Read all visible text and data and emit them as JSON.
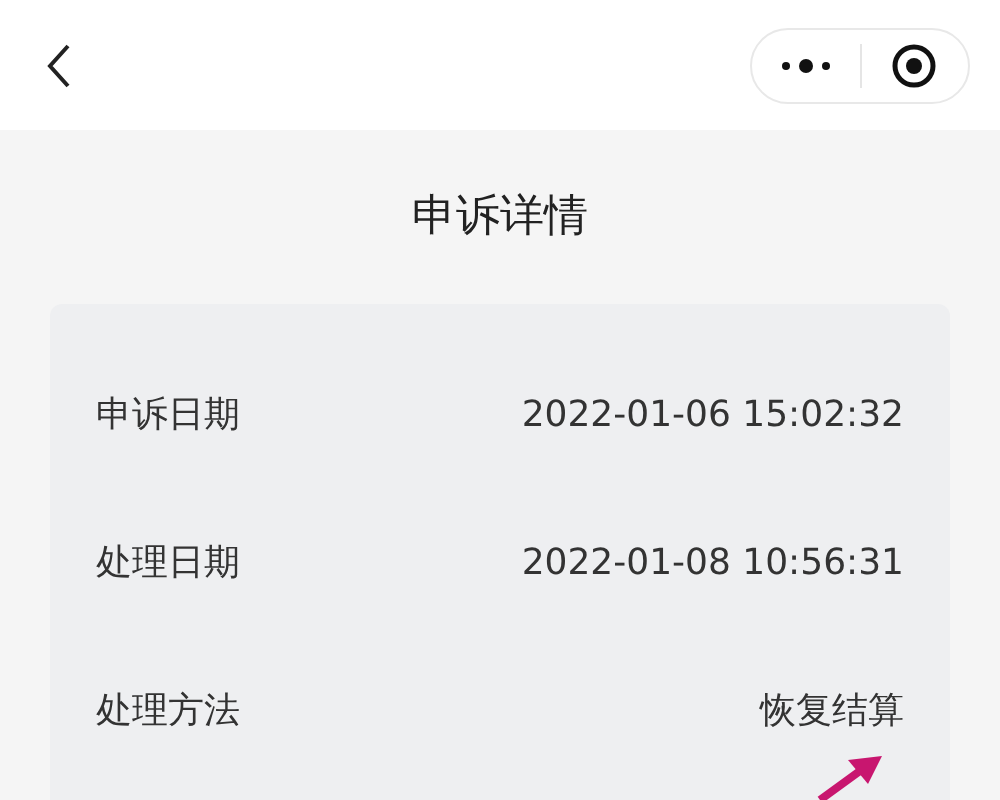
{
  "title": "申诉详情",
  "rows": [
    {
      "label": "申诉日期",
      "value": "2022-01-06 15:02:32"
    },
    {
      "label": "处理日期",
      "value": "2022-01-08 10:56:31"
    },
    {
      "label": "处理方法",
      "value": "恢复结算"
    }
  ]
}
